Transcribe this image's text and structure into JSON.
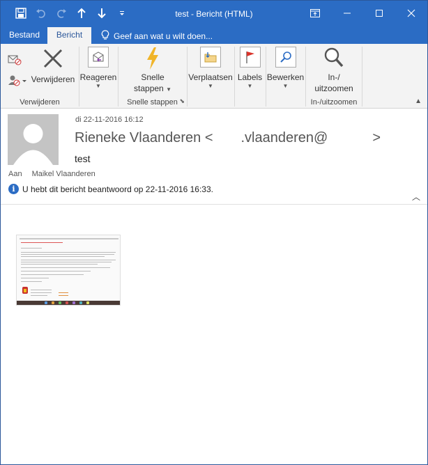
{
  "window": {
    "title": "test - Bericht (HTML)"
  },
  "tabs": {
    "bestand": "Bestand",
    "bericht": "Bericht",
    "tell_me": "Geef aan wat u wilt doen..."
  },
  "ribbon": {
    "groups": {
      "delete": "Verwijderen",
      "quick_steps": "Snelle stappen",
      "zoom": "In-/uitzoomen"
    },
    "buttons": {
      "delete": "Verwijderen",
      "reply": "Reageren",
      "quick_steps_line1": "Snelle",
      "quick_steps_line2": "stappen",
      "move": "Verplaatsen",
      "labels": "Labels",
      "edit": "Bewerken",
      "zoom_line1": "In-/",
      "zoom_line2": "uitzoomen"
    }
  },
  "message": {
    "date": "di 22-11-2016 16:12",
    "sender_name": "Rieneke Vlaanderen",
    "sender_address_open": "<",
    "sender_address_mid": ".vlaanderen@",
    "sender_address_close": ">",
    "subject": "test",
    "to_label": "Aan",
    "to": "Maikel Vlaanderen",
    "info": "U hebt dit bericht beantwoord op 22-11-2016 16:33."
  },
  "colors": {
    "accent": "#2b6cc4",
    "ribbon_bg": "#f3f3f3"
  },
  "icons": {
    "save": "save-icon",
    "undo": "undo-icon",
    "redo": "redo-icon",
    "up": "arrow-up-icon",
    "down": "arrow-down-icon",
    "customize": "customize-qat-icon",
    "restore": "ribbon-display-icon",
    "minimize": "minimize-icon",
    "maximize": "maximize-icon",
    "close": "close-icon",
    "lightbulb": "lightbulb-icon",
    "ignore": "ignore-icon",
    "junk": "junk-icon",
    "delete": "delete-x-icon",
    "reply": "reply-envelope-icon",
    "lightning": "lightning-icon",
    "move": "folder-move-icon",
    "flag": "flag-icon",
    "search": "search-icon",
    "zoom": "magnifier-icon",
    "info": "info-icon",
    "avatar": "person-placeholder-icon"
  }
}
